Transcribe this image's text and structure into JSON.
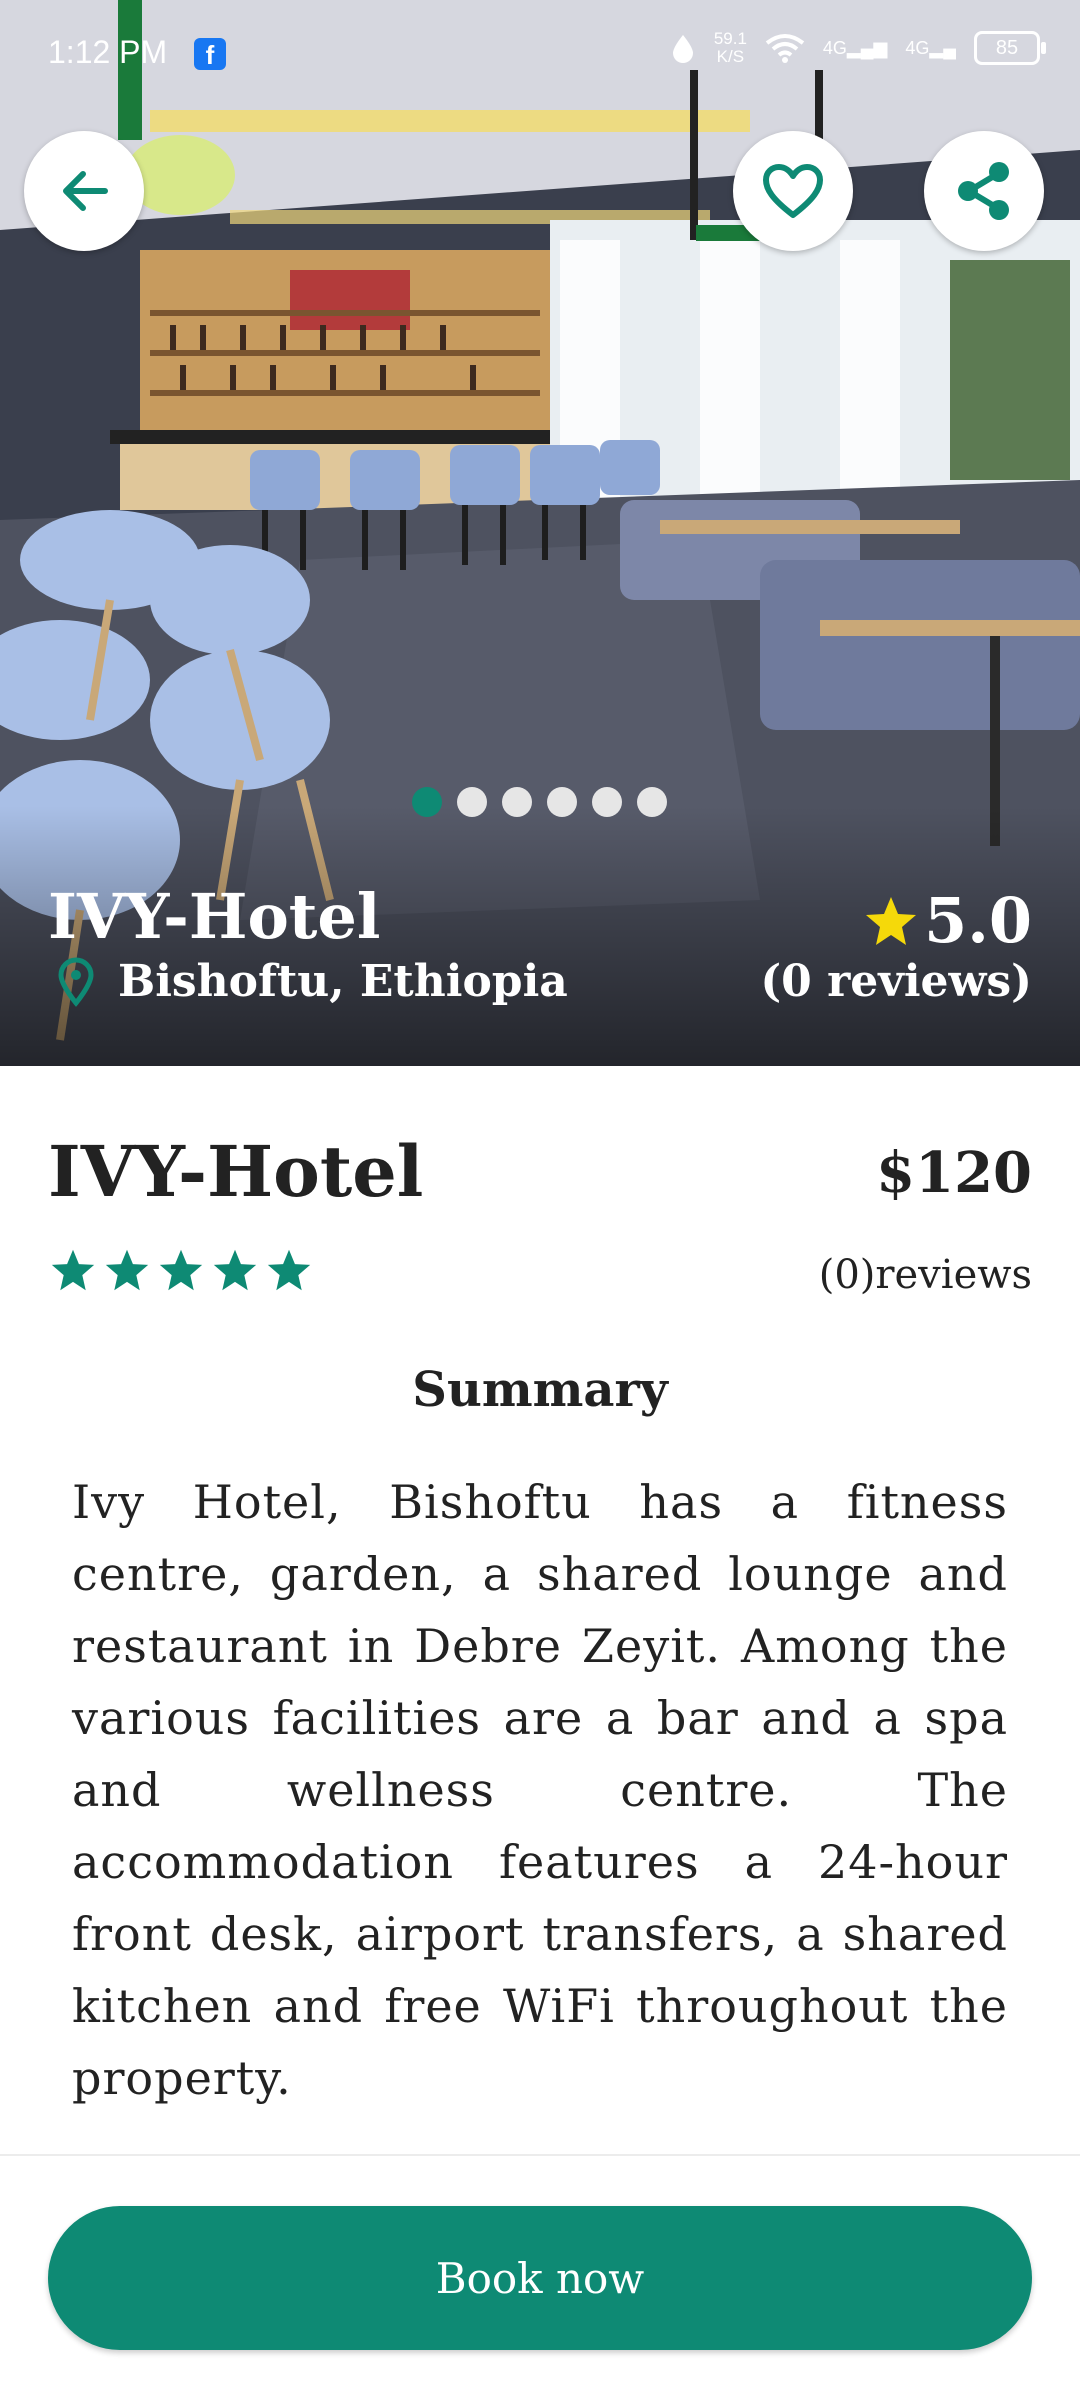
{
  "status_bar": {
    "time": "1:12 PM",
    "net_speed_value": "59.1",
    "net_speed_unit": "K/S",
    "network_1": "4G",
    "network_2": "4G",
    "battery": "85"
  },
  "gallery": {
    "image_count": 6,
    "active_index": 0
  },
  "hero": {
    "title": "IVY-Hotel",
    "location": "Bishoftu, Ethiopia",
    "rating": "5.0",
    "reviews": "(0 reviews)"
  },
  "details": {
    "title": "IVY-Hotel",
    "price": "$120",
    "star_count": 5,
    "reviews": "(0)reviews",
    "summary_heading": "Summary",
    "summary": "Ivy Hotel, Bishoftu has a fitness centre, garden, a shared lounge and restaurant in Debre Zeyit. Among the various facilities are a bar and a spa and wellness centre. The accommodation features a 24-hour front desk, airport transfers, a shared kitchen and free WiFi throughout the property."
  },
  "actions": {
    "book_label": "Book now"
  },
  "icons": {
    "back": "arrow-left-icon",
    "favorite": "heart-icon",
    "share": "share-icon",
    "location": "location-pin-icon",
    "rating": "star-icon"
  },
  "colors": {
    "accent": "#0e8a74",
    "star_yellow": "#f5d90a"
  }
}
